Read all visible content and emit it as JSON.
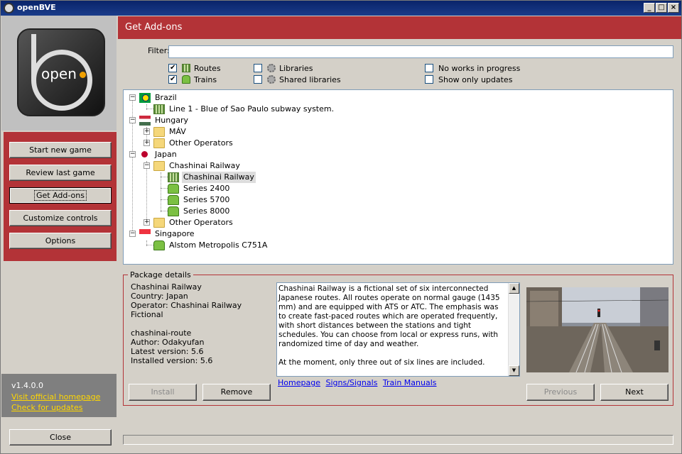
{
  "window": {
    "title": "openBVE"
  },
  "sidebar": {
    "logo_text": "open",
    "menu": [
      {
        "label": "Start new game"
      },
      {
        "label": "Review last game"
      },
      {
        "label": "Get Add-ons",
        "active": true
      },
      {
        "label": "Customize controls"
      },
      {
        "label": "Options"
      }
    ],
    "version": "v1.4.0.0",
    "link_homepage": "Visit official homepage",
    "link_updates": "Check for updates",
    "close_label": "Close"
  },
  "header": {
    "title": "Get Add-ons"
  },
  "filter": {
    "label": "Filter:",
    "value": ""
  },
  "options": {
    "routes": {
      "label": "Routes",
      "checked": true
    },
    "trains": {
      "label": "Trains",
      "checked": true
    },
    "libraries": {
      "label": "Libraries",
      "checked": false
    },
    "shared_libraries": {
      "label": "Shared libraries",
      "checked": false
    },
    "no_wip": {
      "label": "No works in progress",
      "checked": false
    },
    "only_updates": {
      "label": "Show only updates",
      "checked": false
    }
  },
  "tree": {
    "brazil": "Brazil",
    "brazil_line1": "Line 1 - Blue of Sao Paulo subway system.",
    "hungary": "Hungary",
    "mav": "MÁV",
    "hu_other": "Other Operators",
    "japan": "Japan",
    "chashinai_folder": "Chashinai Railway",
    "chashinai_route": "Chashinai Railway",
    "series2400": "Series 2400",
    "series5700": "Series 5700",
    "series8000": "Series 8000",
    "jp_other": "Other Operators",
    "singapore": "Singapore",
    "alstom": "Alstom Metropolis C751A"
  },
  "package": {
    "group_title": "Package details",
    "name": "Chashinai Railway",
    "country": "Country: Japan",
    "operator": "Operator: Chashinai Railway",
    "kind": "Fictional",
    "id": "chashinai-route",
    "author": "Author: Odakyufan",
    "latest": "Latest version: 5.6",
    "installed": "Installed version: 5.6",
    "description_p1": "Chashinai Railway is a fictional set of six interconnected Japanese routes. All routes operate on normal gauge (1435 mm) and are equipped with ATS or ATC. The emphasis was to create fast-paced routes which are operated frequently, with short distances between the stations and tight schedules. You can choose from local or express runs, with randomized time of day and weather.",
    "description_p2": "At the moment, only three out of six lines are included.",
    "link_homepage": "Homepage",
    "link_signs": "Signs/Signals",
    "link_manuals": "Train Manuals",
    "install_label": "Install",
    "remove_label": "Remove",
    "previous_label": "Previous",
    "next_label": "Next"
  },
  "colors": {
    "accent": "#b33337",
    "link": "#0000ee",
    "sidebar_link": "#ffd700"
  }
}
